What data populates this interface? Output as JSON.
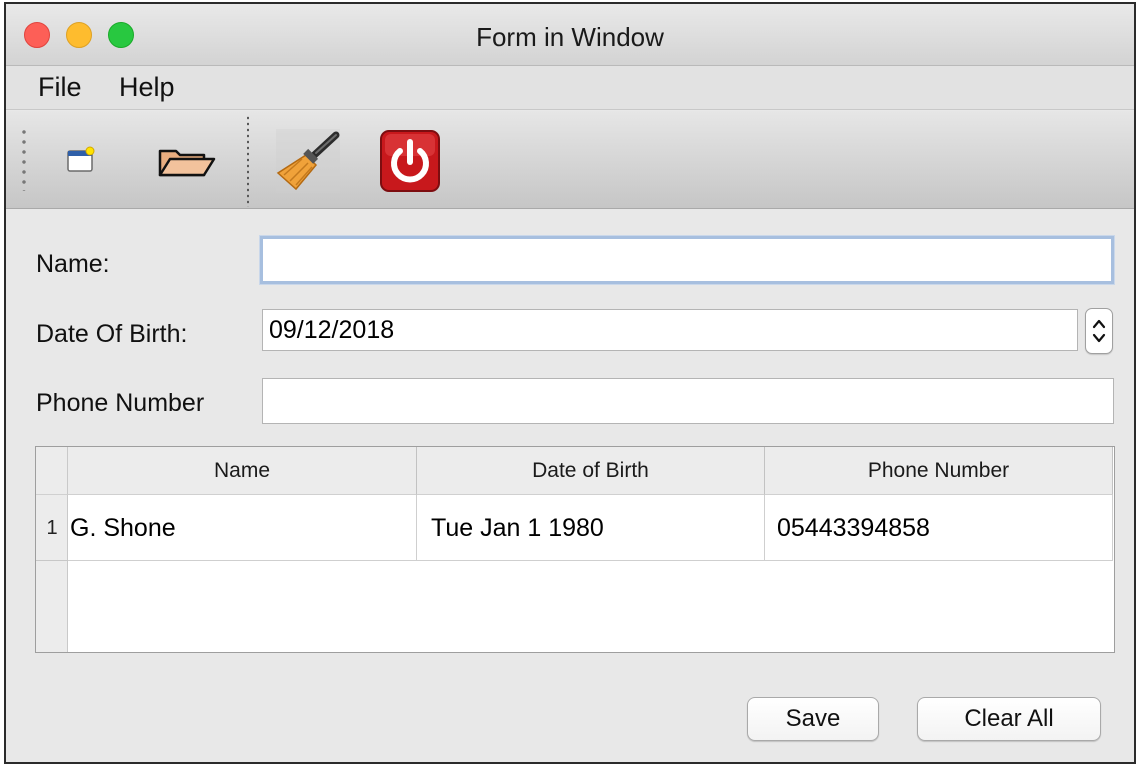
{
  "window": {
    "title": "Form in Window"
  },
  "menu": {
    "file": "File",
    "help": "Help"
  },
  "toolbar": {
    "buttons": [
      {
        "icon": "new-document-icon"
      },
      {
        "icon": "open-folder-icon"
      },
      {
        "icon": "broom-clean-icon"
      },
      {
        "icon": "power-exit-icon"
      }
    ]
  },
  "form": {
    "name_label": "Name:",
    "name_value": "",
    "dob_label": "Date Of Birth:",
    "dob_value": "09/12/2018",
    "phone_label": "Phone Number",
    "phone_value": ""
  },
  "table": {
    "columns": [
      "Name",
      "Date of Birth",
      "Phone Number"
    ],
    "rows": [
      {
        "num": "1",
        "name": "G. Shone",
        "dob": "Tue Jan 1 1980",
        "phone": "05443394858"
      }
    ]
  },
  "buttons": {
    "save": "Save",
    "clear_all": "Clear All"
  },
  "colors": {
    "exit_red": "#c8181c",
    "focus_ring": "#a7bfdf"
  }
}
